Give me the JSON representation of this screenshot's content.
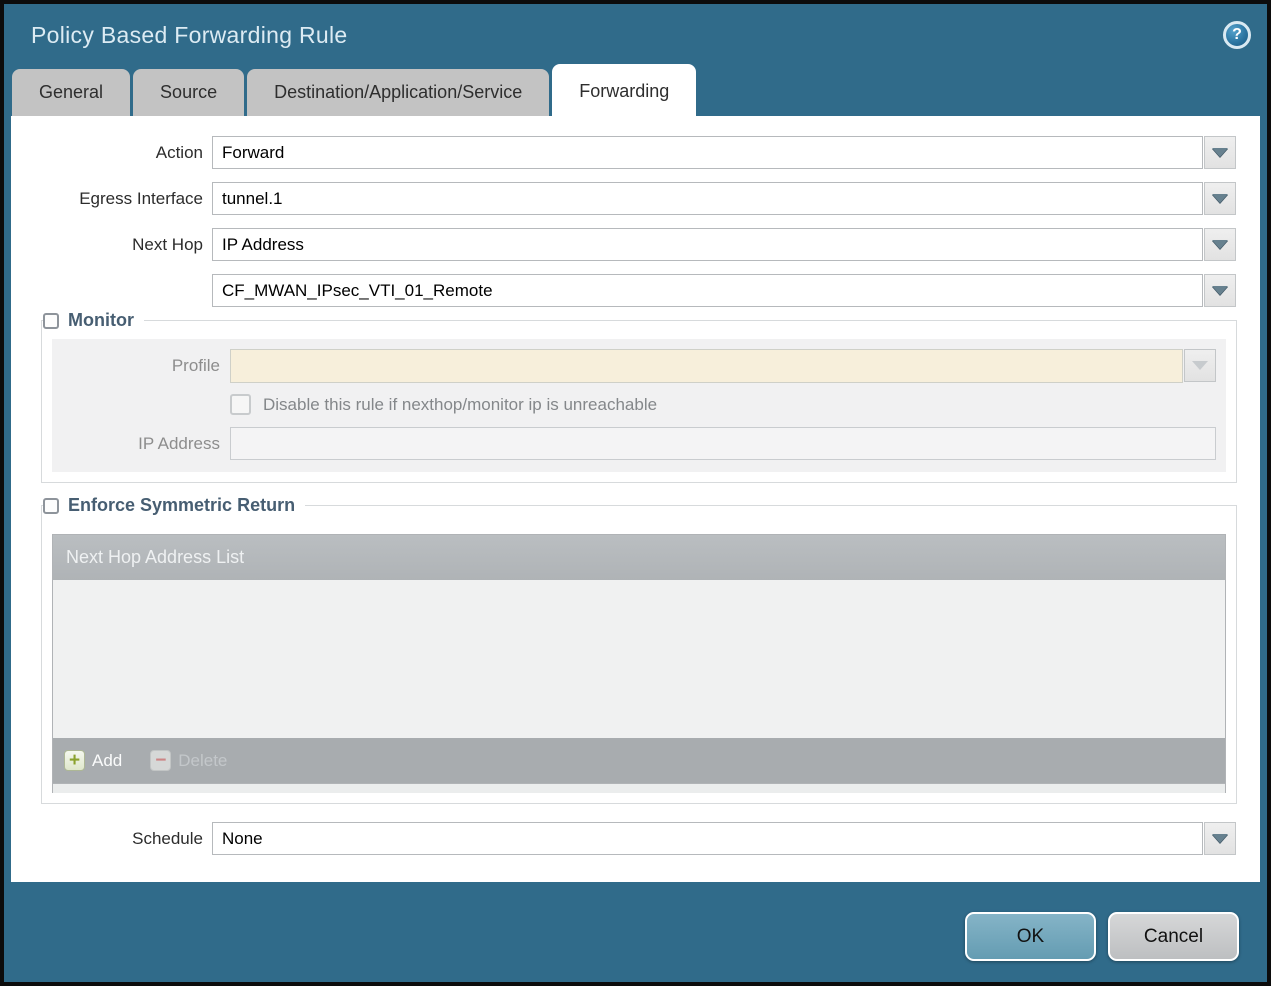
{
  "window": {
    "title": "Policy Based Forwarding Rule",
    "help_glyph": "?"
  },
  "tabs": [
    {
      "label": "General",
      "active": false
    },
    {
      "label": "Source",
      "active": false
    },
    {
      "label": "Destination/Application/Service",
      "active": false
    },
    {
      "label": "Forwarding",
      "active": true
    }
  ],
  "form": {
    "action": {
      "label": "Action",
      "value": "Forward"
    },
    "egress_interface": {
      "label": "Egress Interface",
      "value": "tunnel.1"
    },
    "next_hop": {
      "label": "Next Hop",
      "value": "IP Address"
    },
    "next_hop_value": {
      "value": "CF_MWAN_IPsec_VTI_01_Remote"
    },
    "schedule": {
      "label": "Schedule",
      "value": "None"
    }
  },
  "monitor": {
    "legend": "Monitor",
    "checked": false,
    "profile": {
      "label": "Profile",
      "value": ""
    },
    "disable_rule": {
      "label": "Disable this rule if nexthop/monitor ip is unreachable",
      "checked": false
    },
    "ip_address": {
      "label": "IP Address",
      "value": ""
    }
  },
  "symmetric_return": {
    "legend": "Enforce Symmetric Return",
    "checked": false,
    "table": {
      "header": "Next Hop Address List",
      "rows": []
    },
    "add_label": "Add",
    "delete_label": "Delete"
  },
  "footer": {
    "ok_label": "OK",
    "cancel_label": "Cancel"
  },
  "colors": {
    "titlebar_teal": "#306b8a",
    "tab_inactive": "#c3c3c3",
    "active_tab": "#ffffff",
    "profile_field_bg": "#f7efdb",
    "table_header_gray": "#b3b7ba",
    "table_footer_gray": "#a8acaf",
    "ok_button": "#6ca4bb",
    "cancel_button": "#c9cacb",
    "add_plus_green": "#8ba22d",
    "delete_minus_red": "#cc8585",
    "legend_text": "#475e72"
  }
}
